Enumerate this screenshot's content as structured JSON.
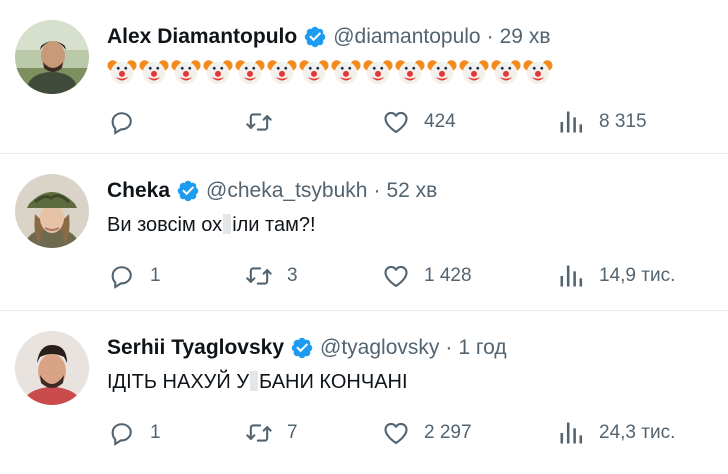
{
  "tweets": [
    {
      "name": "Alex Diamantopulo",
      "handle": "@diamantopulo",
      "separator": "·",
      "time": "29 хв",
      "body_emoji": "🤡",
      "body_emoji_count": 14,
      "replies": "",
      "retweets": "",
      "likes": "424",
      "views": "8 315"
    },
    {
      "name": "Cheka",
      "handle": "@cheka_tsybukh",
      "separator": "·",
      "time": "52 хв",
      "text_before": "Ви зовсім ох",
      "text_after": "іли там?!",
      "replies": "1",
      "retweets": "3",
      "likes": "1 428",
      "views": "14,9 тис."
    },
    {
      "name": "Serhii Tyaglovsky",
      "handle": "@tyaglovsky",
      "separator": "·",
      "time": "1 год",
      "text_before": "ІДІТЬ НАХУЙ У",
      "text_after": "БАНИ КОНЧАНІ",
      "replies": "1",
      "retweets": "7",
      "likes": "2 297",
      "views": "24,3 тис."
    }
  ],
  "icons": {
    "reply": "reply-icon",
    "retweet": "retweet-icon",
    "like": "heart-icon",
    "views": "views-icon",
    "verified": "verified-badge-icon"
  },
  "colors": {
    "verified_blue": "#1d9bf0",
    "secondary_text": "#536471",
    "primary_text": "#0f1419",
    "divider": "#e7e9ea"
  }
}
